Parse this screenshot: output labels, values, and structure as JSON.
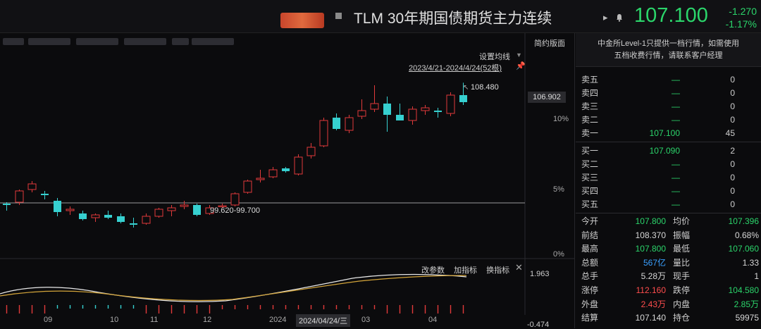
{
  "header": {
    "title": "TLM 30年期国债期货主力连续",
    "price": "107.100",
    "change": "-1.270",
    "change_pct": "-1.17%"
  },
  "chart_toolbar": {
    "version": "简约版面",
    "ma_setting": "设置均线",
    "range": "2023/4/21-2024/4/24(52根)"
  },
  "chart_labels": {
    "high_annotation": "108.480",
    "low_annotation": "99.620-99.700",
    "current_price_tag": "106.902",
    "pct_10": "10%",
    "pct_5": "5%",
    "pct_0": "0%"
  },
  "indicator": {
    "params": "改参数",
    "add": "加指标",
    "switch": "换指标",
    "max": "1.963",
    "min": "-0.474"
  },
  "x_axis": {
    "ticks": [
      "09",
      "10",
      "11",
      "12",
      "2024",
      "03",
      "04"
    ],
    "hover_date": "2024/04/24/三"
  },
  "chart_data": {
    "type": "candlestick",
    "date_range": "2023/4/21-2024/4/24",
    "bar_count": 52,
    "candles": [
      {
        "o": 99.9,
        "h": 100.0,
        "l": 99.4,
        "c": 99.8
      },
      {
        "o": 100.0,
        "h": 100.9,
        "l": 99.8,
        "c": 100.8
      },
      {
        "o": 100.9,
        "h": 101.5,
        "l": 100.7,
        "c": 101.3
      },
      {
        "o": 100.6,
        "h": 100.8,
        "l": 100.2,
        "c": 100.5
      },
      {
        "o": 100.1,
        "h": 100.3,
        "l": 99.0,
        "c": 99.3
      },
      {
        "o": 99.4,
        "h": 99.7,
        "l": 99.1,
        "c": 99.5
      },
      {
        "o": 99.2,
        "h": 99.4,
        "l": 98.7,
        "c": 98.8
      },
      {
        "o": 98.9,
        "h": 99.2,
        "l": 98.6,
        "c": 99.1
      },
      {
        "o": 99.1,
        "h": 99.4,
        "l": 98.8,
        "c": 98.9
      },
      {
        "o": 99.0,
        "h": 99.2,
        "l": 98.5,
        "c": 98.6
      },
      {
        "o": 98.5,
        "h": 98.9,
        "l": 98.2,
        "c": 98.4
      },
      {
        "o": 98.5,
        "h": 99.2,
        "l": 98.4,
        "c": 99.0
      },
      {
        "o": 99.0,
        "h": 99.6,
        "l": 98.9,
        "c": 99.5
      },
      {
        "o": 99.4,
        "h": 99.8,
        "l": 99.0,
        "c": 99.6
      },
      {
        "o": 99.7,
        "h": 100.1,
        "l": 99.5,
        "c": 99.8
      },
      {
        "o": 99.8,
        "h": 99.9,
        "l": 99.0,
        "c": 99.1
      },
      {
        "o": 99.2,
        "h": 99.8,
        "l": 99.1,
        "c": 99.6
      },
      {
        "o": 99.7,
        "h": 99.9,
        "l": 99.6,
        "c": 99.75
      },
      {
        "o": 99.8,
        "h": 100.7,
        "l": 99.7,
        "c": 100.6
      },
      {
        "o": 100.7,
        "h": 101.6,
        "l": 100.6,
        "c": 101.5
      },
      {
        "o": 101.6,
        "h": 102.3,
        "l": 101.4,
        "c": 101.7
      },
      {
        "o": 101.8,
        "h": 102.5,
        "l": 101.7,
        "c": 102.3
      },
      {
        "o": 102.4,
        "h": 102.5,
        "l": 102.1,
        "c": 102.2
      },
      {
        "o": 102.0,
        "h": 103.4,
        "l": 101.9,
        "c": 103.2
      },
      {
        "o": 103.3,
        "h": 104.2,
        "l": 103.1,
        "c": 103.9
      },
      {
        "o": 104.0,
        "h": 106.0,
        "l": 103.9,
        "c": 105.8
      },
      {
        "o": 106.0,
        "h": 106.3,
        "l": 105.1,
        "c": 105.2
      },
      {
        "o": 105.1,
        "h": 106.2,
        "l": 104.9,
        "c": 106.0
      },
      {
        "o": 106.1,
        "h": 107.3,
        "l": 105.9,
        "c": 106.5
      },
      {
        "o": 106.6,
        "h": 108.3,
        "l": 106.4,
        "c": 107.0
      },
      {
        "o": 107.0,
        "h": 107.5,
        "l": 105.0,
        "c": 106.2
      },
      {
        "o": 106.2,
        "h": 107.0,
        "l": 105.8,
        "c": 105.8
      },
      {
        "o": 105.8,
        "h": 106.8,
        "l": 105.5,
        "c": 106.6
      },
      {
        "o": 106.5,
        "h": 106.9,
        "l": 106.2,
        "c": 106.7
      },
      {
        "o": 106.5,
        "h": 106.7,
        "l": 106.0,
        "c": 106.4
      },
      {
        "o": 106.3,
        "h": 107.8,
        "l": 106.1,
        "c": 107.6
      },
      {
        "o": 107.6,
        "h": 108.48,
        "l": 106.9,
        "c": 107.1
      }
    ]
  },
  "right_panel": {
    "notice_line1": "中金所Level-1只提供一档行情，如需使用",
    "notice_line2": "五档收费行情，请联系客户经理",
    "asks": [
      {
        "label": "卖五",
        "price": "—",
        "vol": "0"
      },
      {
        "label": "卖四",
        "price": "—",
        "vol": "0"
      },
      {
        "label": "卖三",
        "price": "—",
        "vol": "0"
      },
      {
        "label": "卖二",
        "price": "—",
        "vol": "0"
      },
      {
        "label": "卖一",
        "price": "107.100",
        "vol": "45"
      }
    ],
    "bids": [
      {
        "label": "买一",
        "price": "107.090",
        "vol": "2"
      },
      {
        "label": "买二",
        "price": "—",
        "vol": "0"
      },
      {
        "label": "买三",
        "price": "—",
        "vol": "0"
      },
      {
        "label": "买四",
        "price": "—",
        "vol": "0"
      },
      {
        "label": "买五",
        "price": "—",
        "vol": "0"
      }
    ],
    "stats": [
      {
        "l1": "今开",
        "v1": "107.800",
        "c1": "g",
        "l2": "均价",
        "v2": "107.396",
        "c2": "g"
      },
      {
        "l1": "前结",
        "v1": "108.370",
        "c1": "w",
        "l2": "振幅",
        "v2": "0.68%",
        "c2": "w"
      },
      {
        "l1": "最高",
        "v1": "107.800",
        "c1": "g",
        "l2": "最低",
        "v2": "107.060",
        "c2": "g"
      },
      {
        "l1": "总额",
        "v1": "567亿",
        "c1": "b",
        "l2": "量比",
        "v2": "1.33",
        "c2": "w"
      },
      {
        "l1": "总手",
        "v1": "5.28万",
        "c1": "w",
        "l2": "现手",
        "v2": "1",
        "c2": "w"
      },
      {
        "l1": "涨停",
        "v1": "112.160",
        "c1": "r",
        "l2": "跌停",
        "v2": "104.580",
        "c2": "g"
      },
      {
        "l1": "外盘",
        "v1": "2.43万",
        "c1": "r",
        "l2": "内盘",
        "v2": "2.85万",
        "c2": "g"
      },
      {
        "l1": "结算",
        "v1": "107.140",
        "c1": "w",
        "l2": "持仓",
        "v2": "59975",
        "c2": "w"
      }
    ]
  }
}
